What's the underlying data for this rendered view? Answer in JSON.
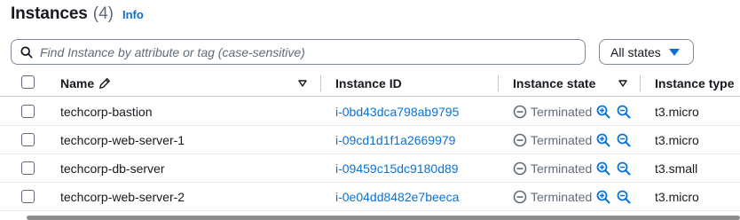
{
  "header": {
    "title": "Instances",
    "count": "(4)",
    "info": "Info"
  },
  "search": {
    "placeholder": "Find Instance by attribute or tag (case-sensitive)"
  },
  "filter": {
    "selected": "All states"
  },
  "columns": {
    "name": "Name",
    "instance_id": "Instance ID",
    "instance_state": "Instance state",
    "instance_type": "Instance type"
  },
  "rows": [
    {
      "name": "techcorp-bastion",
      "id": "i-0bd43dca798ab9795",
      "state": "Terminated",
      "type": "t3.micro"
    },
    {
      "name": "techcorp-web-server-1",
      "id": "i-09cd1d1f1a2669979",
      "state": "Terminated",
      "type": "t3.micro"
    },
    {
      "name": "techcorp-db-server",
      "id": "i-09459c15dc9180d89",
      "state": "Terminated",
      "type": "t3.small"
    },
    {
      "name": "techcorp-web-server-2",
      "id": "i-0e04dd8482e7beeca",
      "state": "Terminated",
      "type": "t3.micro"
    }
  ],
  "colors": {
    "link": "#0972d3",
    "muted": "#5f6b7a",
    "text": "#16191f",
    "border": "#c6c6cd"
  }
}
